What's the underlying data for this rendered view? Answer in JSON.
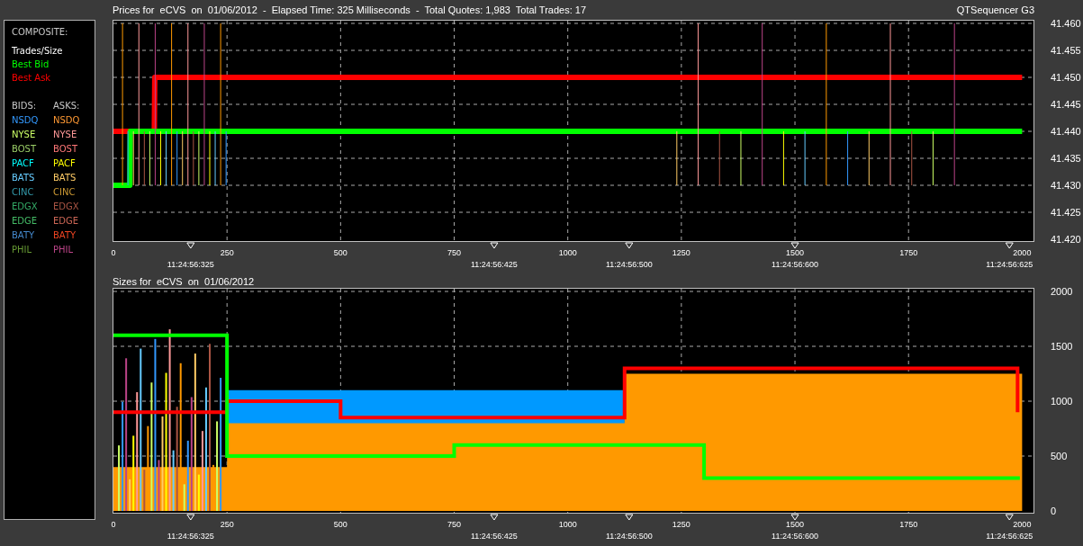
{
  "legend": {
    "composite_title": "COMPOSITE:",
    "composite": [
      {
        "label": "Trades/Size",
        "color": "#ffffff"
      },
      {
        "label": "Best Bid",
        "color": "#00ff00"
      },
      {
        "label": "Best Ask",
        "color": "#ff0000"
      }
    ],
    "bids_title": "BIDS:",
    "asks_title": "ASKS:",
    "exchanges": [
      {
        "bid": {
          "label": "NSDQ",
          "color": "#3399ff"
        },
        "ask": {
          "label": "NSDQ",
          "color": "#ff9933"
        }
      },
      {
        "bid": {
          "label": "NYSE",
          "color": "#ccff66"
        },
        "ask": {
          "label": "NYSE",
          "color": "#ff9999"
        }
      },
      {
        "bid": {
          "label": "BOST",
          "color": "#99cc66"
        },
        "ask": {
          "label": "BOST",
          "color": "#ff7777"
        }
      },
      {
        "bid": {
          "label": "PACF",
          "color": "#00ffff"
        },
        "ask": {
          "label": "PACF",
          "color": "#ffff00"
        }
      },
      {
        "bid": {
          "label": "BATS",
          "color": "#66ccff"
        },
        "ask": {
          "label": "BATS",
          "color": "#ffcc66"
        }
      },
      {
        "bid": {
          "label": "CINC",
          "color": "#3399aa"
        },
        "ask": {
          "label": "CINC",
          "color": "#cc9933"
        }
      },
      {
        "bid": {
          "label": "EDGX",
          "color": "#33aa66"
        },
        "ask": {
          "label": "EDGX",
          "color": "#aa5544"
        }
      },
      {
        "bid": {
          "label": "EDGE",
          "color": "#44bb66"
        },
        "ask": {
          "label": "EDGE",
          "color": "#cc6655"
        }
      },
      {
        "bid": {
          "label": "BATY",
          "color": "#4488cc"
        },
        "ask": {
          "label": "BATY",
          "color": "#ee4422"
        }
      },
      {
        "bid": {
          "label": "PHIL",
          "color": "#669933"
        },
        "ask": {
          "label": "PHIL",
          "color": "#bb4488"
        }
      }
    ]
  },
  "prices": {
    "title": "Prices for  eCVS  on  01/06/2012  -  Elapsed Time: 325 Milliseconds  -  Total Quotes: 1,983  Total Trades: 17",
    "app_name": "QTSequencer G3",
    "chart_data": {
      "type": "line",
      "x": [
        0,
        36,
        37,
        90,
        91,
        2000
      ],
      "series": [
        {
          "color": "#ff0000",
          "values": [
            41.44,
            41.44,
            41.44,
            41.44,
            41.45,
            41.45
          ]
        },
        {
          "color": "#00ff00",
          "values": [
            41.43,
            41.43,
            41.44,
            41.44,
            41.44,
            41.44
          ]
        }
      ],
      "xlim": [
        0,
        2025
      ],
      "ylim": [
        41.42,
        41.46
      ],
      "grid": true,
      "xticks": [
        0,
        250,
        500,
        750,
        1000,
        1250,
        1500,
        1750,
        2000
      ],
      "yticks": [
        {
          "value": 41.46,
          "label": "41.460"
        },
        {
          "value": 41.455,
          "label": "41.455"
        },
        {
          "value": 41.45,
          "label": "41.450"
        },
        {
          "value": 41.445,
          "label": "41.445"
        },
        {
          "value": 41.44,
          "label": "41.440"
        },
        {
          "value": 41.435,
          "label": "41.435"
        },
        {
          "value": 41.43,
          "label": "41.430"
        },
        {
          "value": 41.425,
          "label": "41.425"
        },
        {
          "value": 41.42,
          "label": "41.420"
        }
      ],
      "annotations": [
        "11:24:56:325",
        "11:24:56:425",
        "11:24:56:500",
        "11:24:56:600",
        "11:24:56:625"
      ]
    }
  },
  "sizes": {
    "title": "Sizes for  eCVS  on  01/06/2012",
    "chart_data": {
      "type": "area",
      "x": [
        0,
        250,
        251,
        1125,
        1126,
        2000
      ],
      "series": [
        {
          "color": "#0099ff",
          "values": [
            null,
            null,
            1100,
            1100,
            0,
            0
          ]
        },
        {
          "color": "#ff9900",
          "values": [
            400,
            400,
            800,
            800,
            1250,
            1250
          ]
        }
      ],
      "xlim": [
        0,
        2025
      ],
      "ylim": [
        0,
        2000
      ],
      "grid": true,
      "xticks": [
        0,
        250,
        500,
        750,
        1000,
        1250,
        1500,
        1750,
        2000
      ],
      "yticks": [
        0,
        500,
        1000,
        1500,
        2000
      ],
      "annotations": [
        "11:24:56:325",
        "11:24:56:425",
        "11:24:56:500",
        "11:24:56:600",
        "11:24:56:625"
      ]
    }
  }
}
